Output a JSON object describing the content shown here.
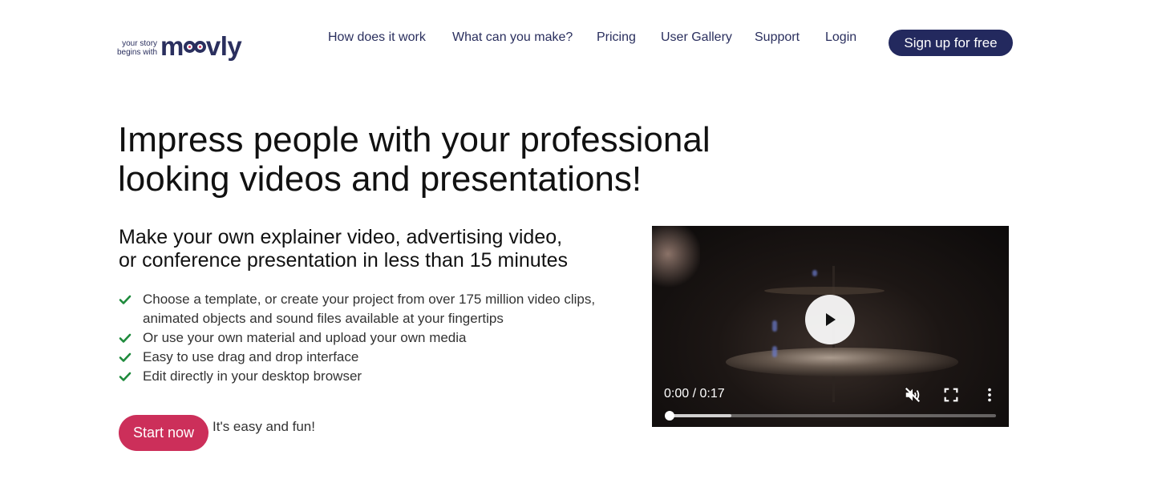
{
  "logo": {
    "tagline_line1": "your story",
    "tagline_line2": "begins with",
    "word_start": "m",
    "word_end": "vly"
  },
  "nav": {
    "items": [
      {
        "label": "How does it work"
      },
      {
        "label": "What can you make?"
      },
      {
        "label": "Pricing"
      },
      {
        "label": "User Gallery"
      },
      {
        "label": "Support"
      },
      {
        "label": "Login"
      }
    ],
    "signup_label": "Sign up for free"
  },
  "hero": {
    "title_line1": "Impress people with your professional",
    "title_line2": "looking videos and presentations!",
    "subtitle_line1": "Make your own explainer video, advertising video,",
    "subtitle_line2": "or conference presentation in less than 15 minutes",
    "features": [
      {
        "line1": "Choose a template, or create your project from over 175 million video clips,",
        "line2": "animated objects and sound files available at your fingertips"
      },
      {
        "line1": "Or use your own material and upload your own media",
        "line2": ""
      },
      {
        "line1": "Easy to use drag and drop interface",
        "line2": ""
      },
      {
        "line1": "Edit directly in your desktop browser",
        "line2": ""
      }
    ],
    "cta_label": "Start now",
    "cta_note": "It's easy and fun!"
  },
  "video": {
    "time_display": "0:00 / 0:17",
    "progress_fraction": 0.0,
    "buffered_fraction": 0.19,
    "muted": true
  },
  "colors": {
    "brand_navy": "#23295e",
    "brand_pink": "#cc2f5a",
    "check_green": "#1e8a3c"
  },
  "icons": {
    "play": "play-icon",
    "mute": "volume-muted-icon",
    "fullscreen": "fullscreen-icon",
    "more": "more-vertical-icon",
    "check": "checkmark-icon"
  }
}
